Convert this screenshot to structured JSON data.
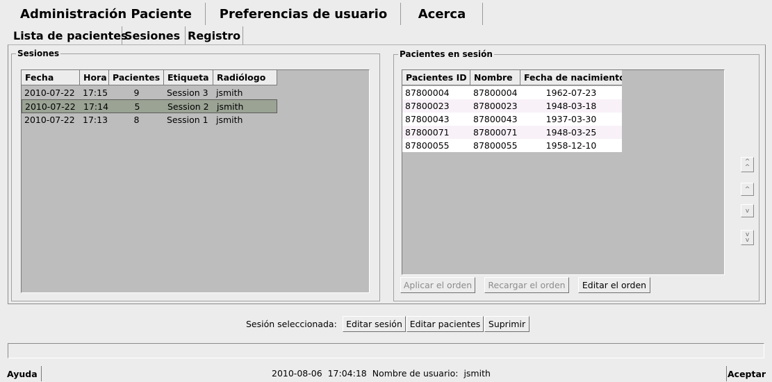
{
  "top_tabs": [
    "Administración Paciente",
    "Preferencias de usuario",
    "Acerca"
  ],
  "sub_tabs": [
    "Lista de pacientes",
    "Sesiones",
    "Registro"
  ],
  "sessions": {
    "legend": "Sesiones",
    "columns": [
      "Fecha",
      "Hora",
      "Pacientes",
      "Etiqueta",
      "Radiólogo"
    ],
    "rows": [
      {
        "fecha": "2010-07-22",
        "hora": "17:15",
        "pacientes": "9",
        "etiqueta": "Session 3",
        "radiologo": "jsmith"
      },
      {
        "fecha": "2010-07-22",
        "hora": "17:14",
        "pacientes": "5",
        "etiqueta": "Session 2",
        "radiologo": "jsmith"
      },
      {
        "fecha": "2010-07-22",
        "hora": "17:13",
        "pacientes": "8",
        "etiqueta": "Session 1",
        "radiologo": "jsmith"
      }
    ],
    "selected_row": 1
  },
  "patients": {
    "legend": "Pacientes en sesión",
    "columns": [
      "Pacientes ID",
      "Nombre",
      "Fecha de nacimiento"
    ],
    "rows": [
      {
        "id": "87800004",
        "nombre": "87800004",
        "nacimiento": "1962-07-23"
      },
      {
        "id": "87800023",
        "nombre": "87800023",
        "nacimiento": "1948-03-18"
      },
      {
        "id": "87800043",
        "nombre": "87800043",
        "nacimiento": "1937-03-30"
      },
      {
        "id": "87800071",
        "nombre": "87800071",
        "nacimiento": "1948-03-25"
      },
      {
        "id": "87800055",
        "nombre": "87800055",
        "nacimiento": "1958-12-10"
      }
    ],
    "buttons": {
      "apply": "Aplicar el orden",
      "reload": "Recargar el orden",
      "edit": "Editar el orden"
    }
  },
  "arrows": {
    "top": "move-to-top-icon",
    "up": "move-up-icon",
    "down": "move-down-icon",
    "bottom": "move-to-bottom-icon"
  },
  "actions": {
    "label": "Sesión seleccionada:",
    "edit_session": "Editar sesión",
    "edit_patients": "Editar pacientes",
    "delete": "Suprimir"
  },
  "footer": {
    "help": "Ayuda",
    "datetime": "2010-08-06  17:04:18",
    "user_label": "Nombre de usuario:",
    "user": "jsmith",
    "accept": "Aceptar"
  },
  "colors": {
    "background": "#ececec",
    "table_empty": "#bdbdbd",
    "row_white": "#ffffff",
    "row_alt": "#f8f2f8",
    "selected_row": "#9aa394"
  }
}
